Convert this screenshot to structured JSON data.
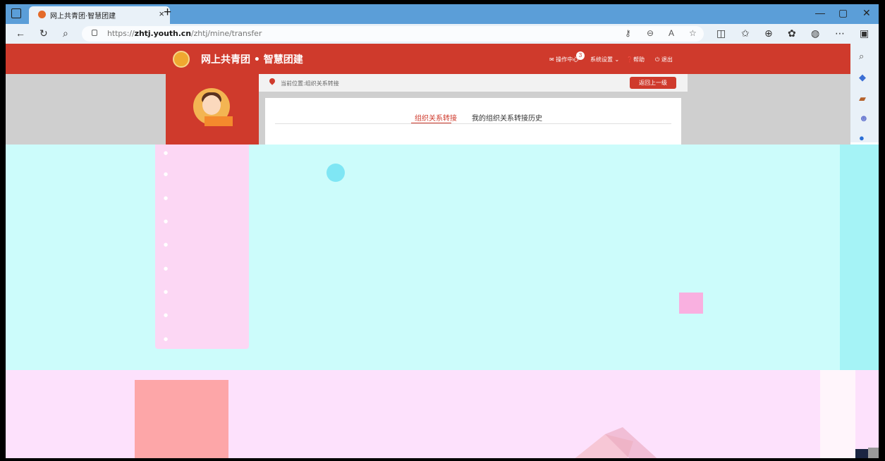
{
  "browser": {
    "tab_title": "网上共青团·智慧团建",
    "tab_close": "×",
    "new_tab": "+",
    "url_prefix": "https://",
    "url_host": "zhtj.youth.cn",
    "url_path": "/zhtj/mine/transfer",
    "window_controls": [
      "—",
      "▢",
      "✕"
    ],
    "toolbar_icons": [
      "back-icon",
      "refresh-icon",
      "search-icon"
    ],
    "address_icons": [
      "key-icon",
      "zoom-icon",
      "read-aloud-icon",
      "favorite-star-icon"
    ],
    "right_icons": [
      "split-screen-icon",
      "favorites-icon",
      "collections-icon",
      "extensions-icon",
      "profile-icon",
      "more-icon",
      "sidebar-toggle-icon"
    ],
    "sidebar_icons": [
      "search-icon",
      "tag-icon",
      "briefcase-icon",
      "people-icon",
      "outlook-icon"
    ]
  },
  "site": {
    "title": "网上共青团 • 智慧团建",
    "header_links": {
      "ops_center": "操作中心",
      "ops_badge": "3",
      "settings": "系统设置",
      "help": "帮助",
      "logout": "退出"
    },
    "breadcrumb": "当前位置:组织关系转接",
    "back_button": "返回上一级",
    "tabs": [
      {
        "label": "组织关系转接",
        "active": true
      },
      {
        "label": "我的组织关系转接历史",
        "active": false
      }
    ]
  },
  "colors": {
    "brand_red": "#cf3a2c",
    "browser_blue": "#5b9ed8",
    "toolbar_bg": "#e9f1f8",
    "glitch_cyan": "#ccfcfb",
    "glitch_pink": "#fde1fc"
  }
}
